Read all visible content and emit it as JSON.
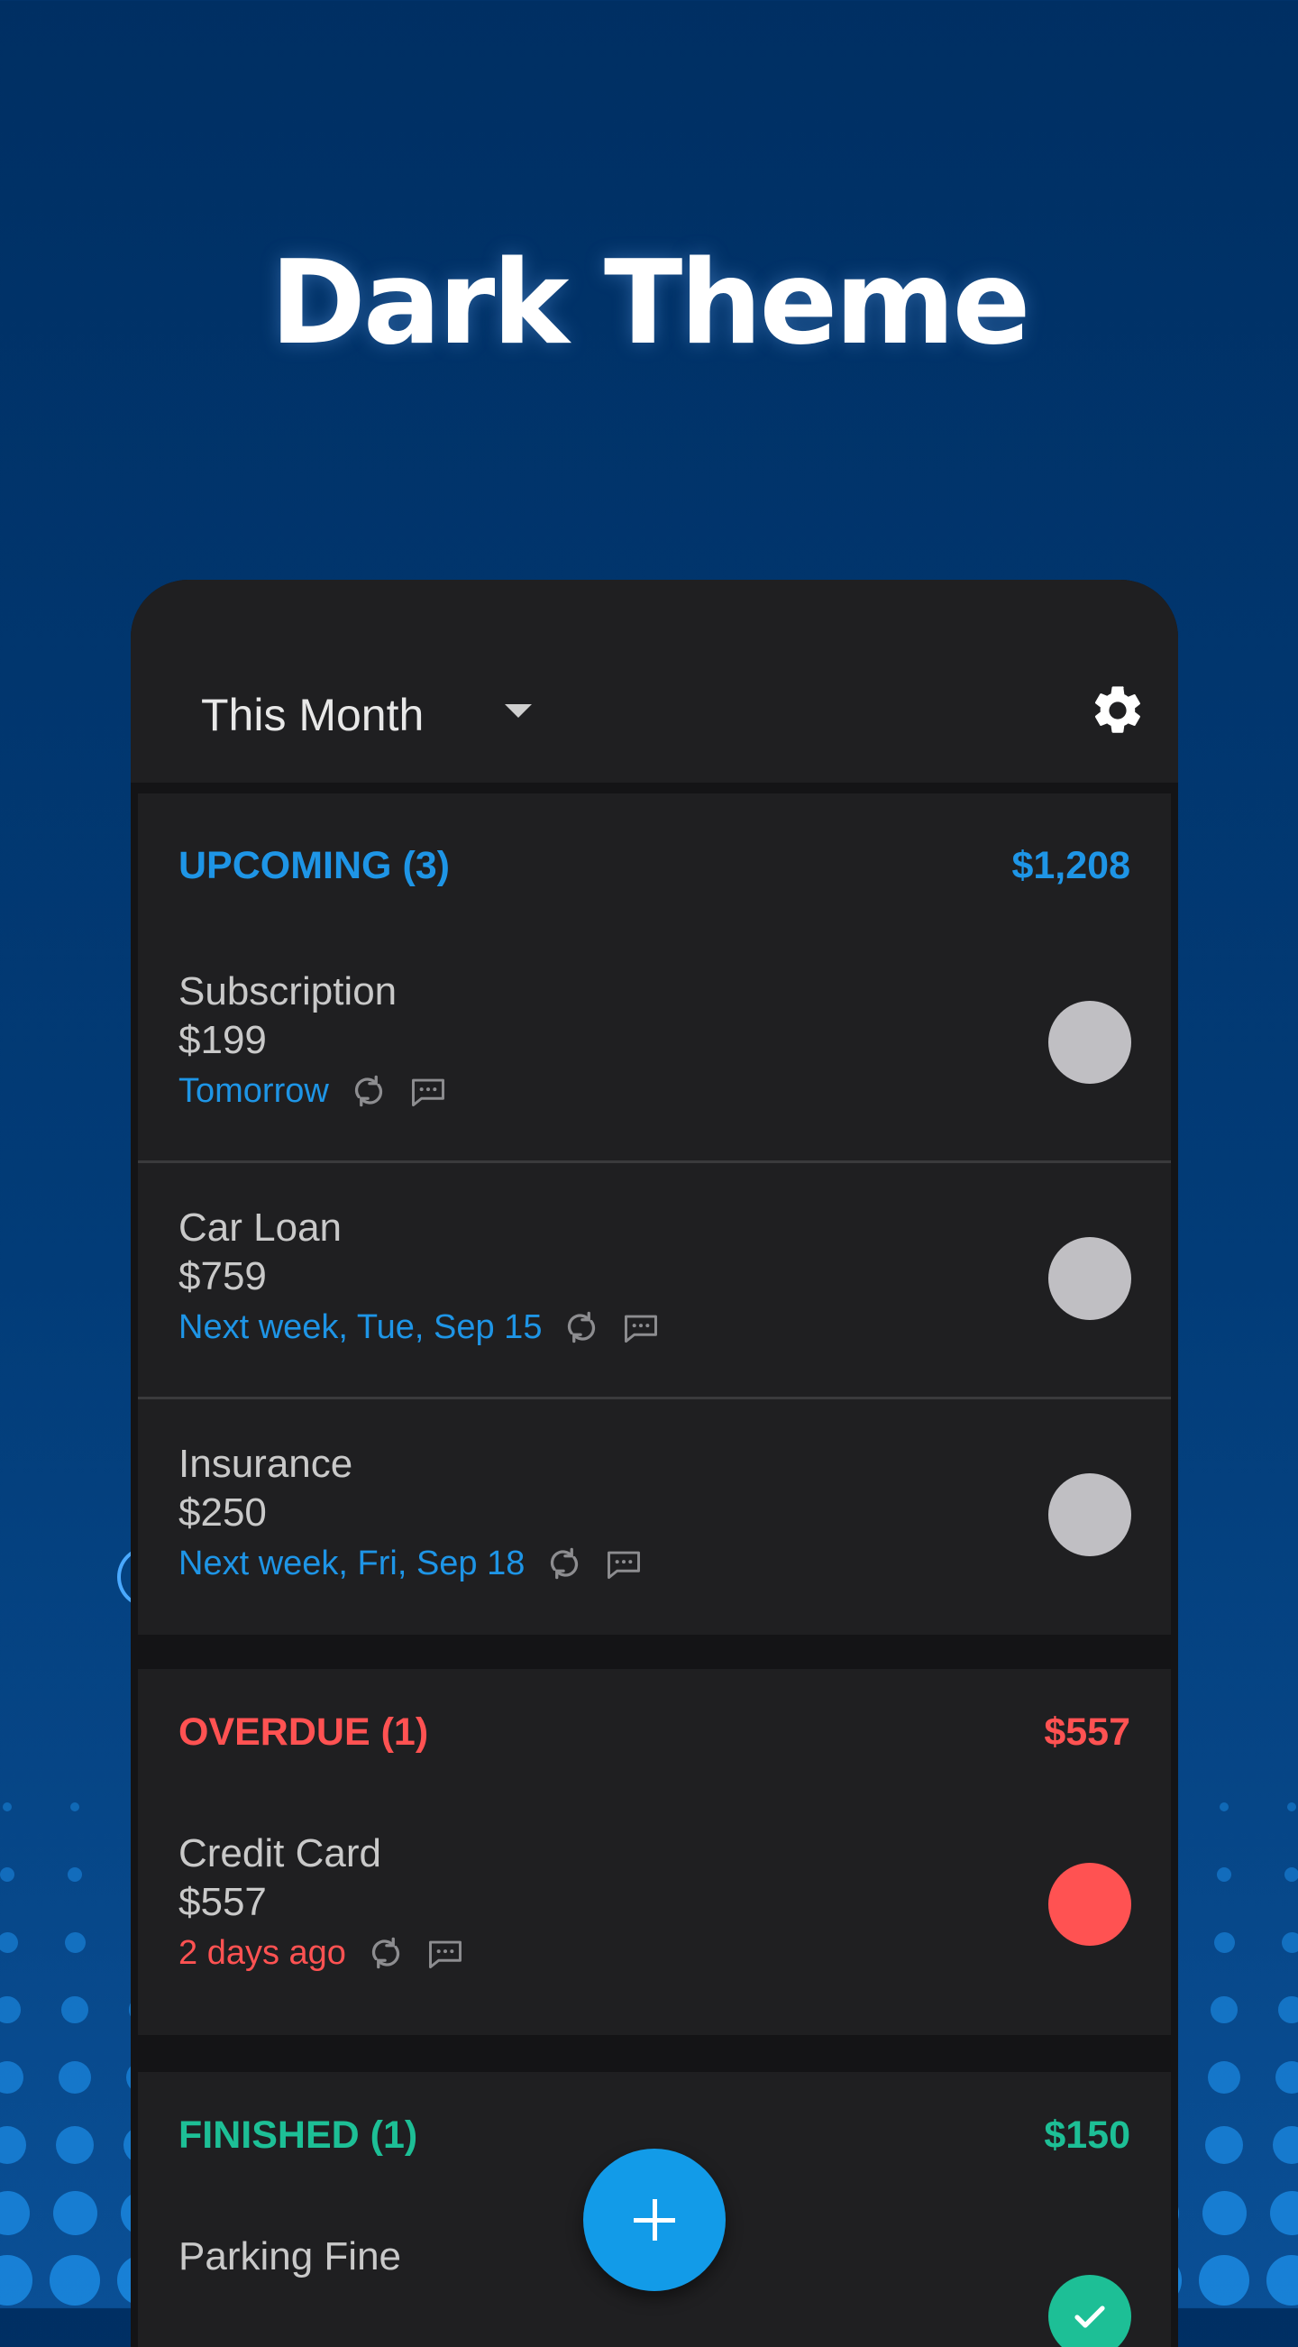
{
  "headline": "Dark Theme",
  "appbar": {
    "period": "This Month",
    "settings_icon": "gear-icon"
  },
  "colors": {
    "upcoming": "#1e95e6",
    "overdue": "#ff5252",
    "finished": "#1dbf96",
    "pending_status": "#c0bfc3",
    "overdue_status": "#ff5252",
    "finished_status": "#1dbf96",
    "fab": "#129be8"
  },
  "sections": {
    "upcoming": {
      "title": "UPCOMING (3)",
      "total": "$1,208",
      "items": [
        {
          "name": "Subscription",
          "amount": "$199",
          "due": "Tomorrow"
        },
        {
          "name": "Car Loan",
          "amount": "$759",
          "due": "Next week, Tue, Sep 15"
        },
        {
          "name": "Insurance",
          "amount": "$250",
          "due": "Next week, Fri, Sep 18"
        }
      ]
    },
    "overdue": {
      "title": "OVERDUE (1)",
      "total": "$557",
      "items": [
        {
          "name": "Credit Card",
          "amount": "$557",
          "due": "2 days ago"
        }
      ]
    },
    "finished": {
      "title": "FINISHED (1)",
      "total": "$150",
      "items": [
        {
          "name": "Parking Fine"
        }
      ]
    }
  },
  "icons": {
    "repeat": "repeat-icon",
    "note": "note-icon",
    "add": "plus-icon",
    "check": "check-icon"
  }
}
